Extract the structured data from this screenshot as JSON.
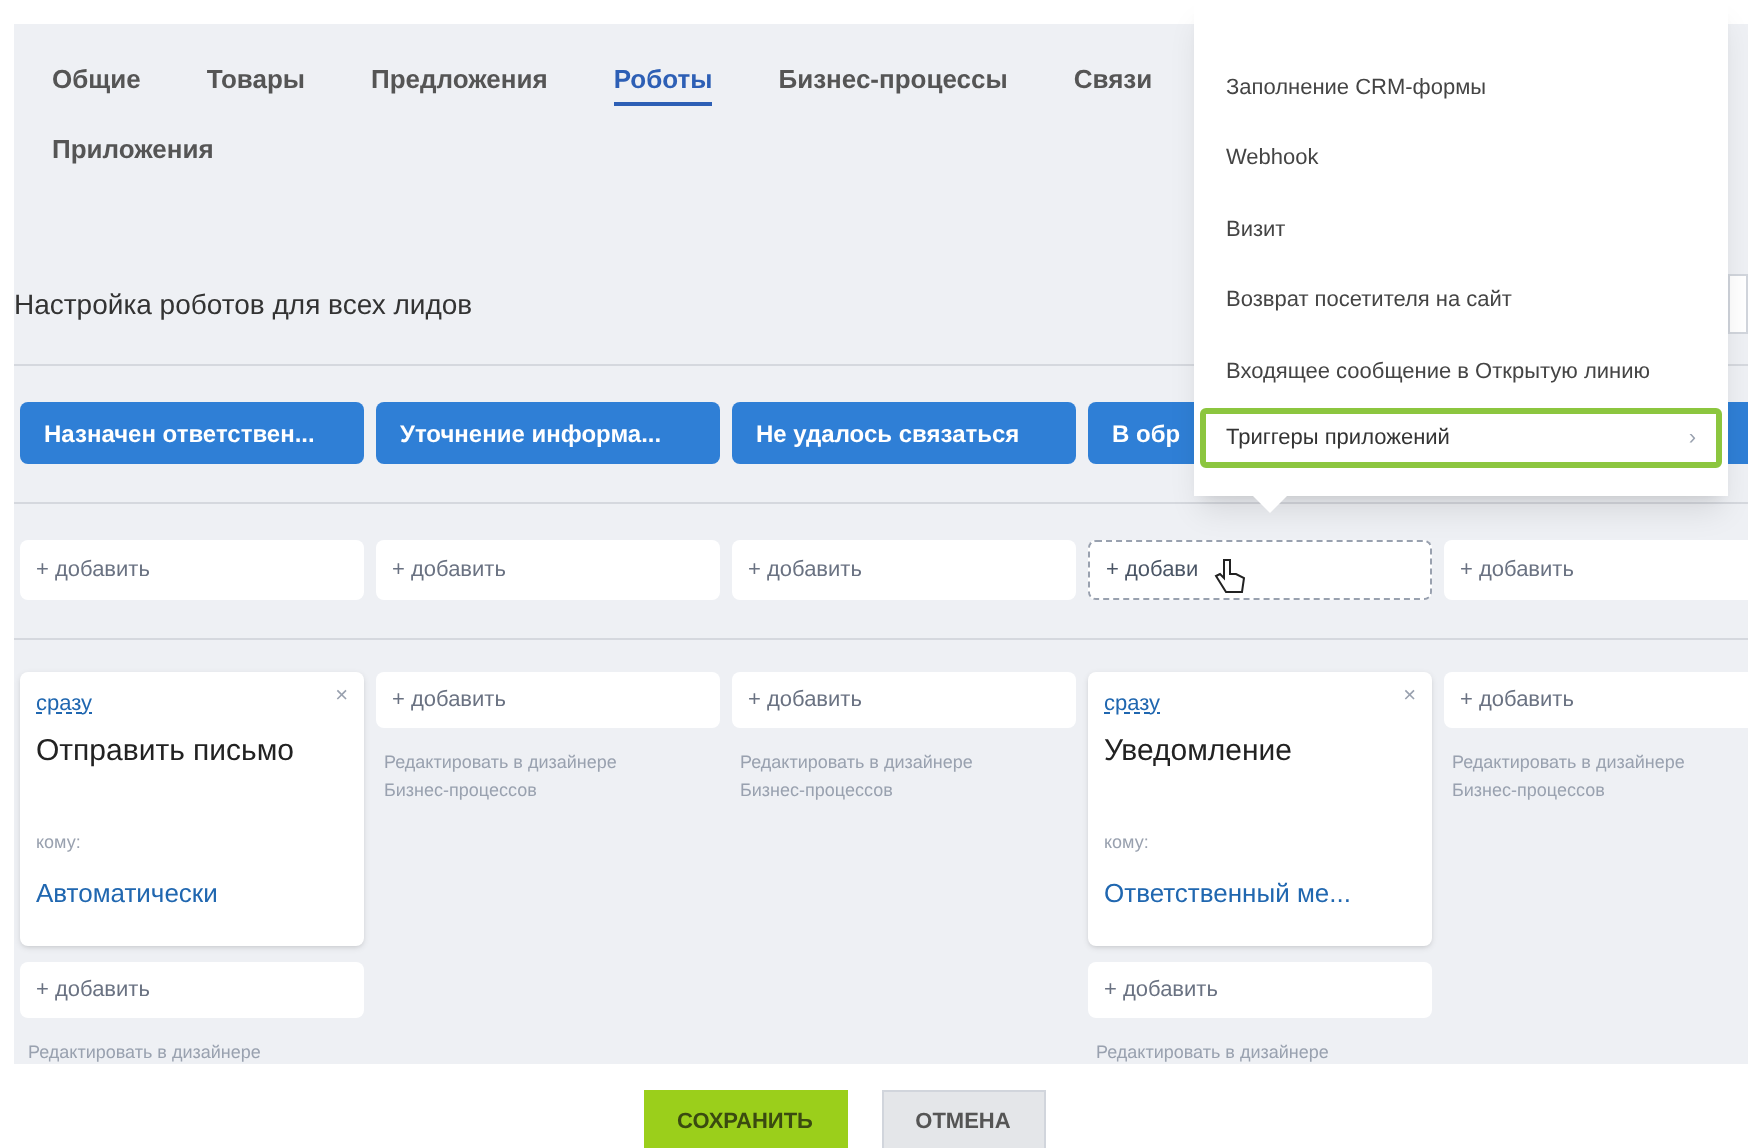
{
  "tabs": [
    {
      "label": "Общие",
      "selected": false
    },
    {
      "label": "Товары",
      "selected": false
    },
    {
      "label": "Предложения",
      "selected": false
    },
    {
      "label": "Роботы",
      "selected": true
    },
    {
      "label": "Бизнес-процессы",
      "selected": false
    },
    {
      "label": "Связи",
      "selected": false
    },
    {
      "label": "Приложения",
      "selected": false
    }
  ],
  "title": "Настройка роботов для всех лидов",
  "columns": [
    {
      "stage": "Назначен ответствен...",
      "trigger": {
        "label": "+ добавить",
        "hovered": false
      },
      "robots": [
        {
          "kind": "card",
          "delay": "сразу",
          "close": "×",
          "name": "Отправить письмо",
          "to_label": "кому:",
          "to_value": "Автоматически"
        },
        {
          "kind": "add",
          "label": "+ добавить"
        }
      ],
      "edit": "Редактировать в дизайнере"
    },
    {
      "stage": "Уточнение информа...",
      "trigger": {
        "label": "+ добавить",
        "hovered": false
      },
      "robots": [
        {
          "kind": "add",
          "label": "+ добавить"
        }
      ],
      "edit": "Редактировать в дизайнере Бизнес-процессов"
    },
    {
      "stage": "Не удалось связаться",
      "trigger": {
        "label": "+ добавить",
        "hovered": false
      },
      "robots": [
        {
          "kind": "add",
          "label": "+ добавить"
        }
      ],
      "edit": "Редактировать в дизайнере Бизнес-процессов"
    },
    {
      "stage": "В обр",
      "trigger": {
        "label": "+ добави",
        "hovered": true
      },
      "robots": [
        {
          "kind": "card",
          "delay": "сразу",
          "close": "×",
          "name": "Уведомление",
          "to_label": "кому:",
          "to_value": "Ответственный ме..."
        },
        {
          "kind": "add",
          "label": "+ добавить"
        }
      ],
      "edit": "Редактировать в дизайнере"
    },
    {
      "trigger": {
        "label": "+ добавить",
        "hovered": false
      },
      "robots": [
        {
          "kind": "add",
          "label": "+ добавить"
        }
      ],
      "edit": "Редактировать в дизайнере Бизнес-процессов"
    }
  ],
  "menu": [
    {
      "label": "Заполнение CRM-формы",
      "highlighted": false
    },
    {
      "label": "Webhook",
      "highlighted": false
    },
    {
      "label": "Визит",
      "highlighted": false
    },
    {
      "label": "Возврат посетителя на сайт",
      "highlighted": false
    },
    {
      "label": "Входящее сообщение в Открытую линию",
      "highlighted": false
    },
    {
      "label": "Триггеры приложений",
      "highlighted": true,
      "submenu": "›"
    }
  ],
  "buttons": [
    {
      "label": "СОХРАНИТЬ",
      "kind": "primary"
    },
    {
      "label": "ОТМЕНА",
      "kind": "secondary"
    }
  ]
}
